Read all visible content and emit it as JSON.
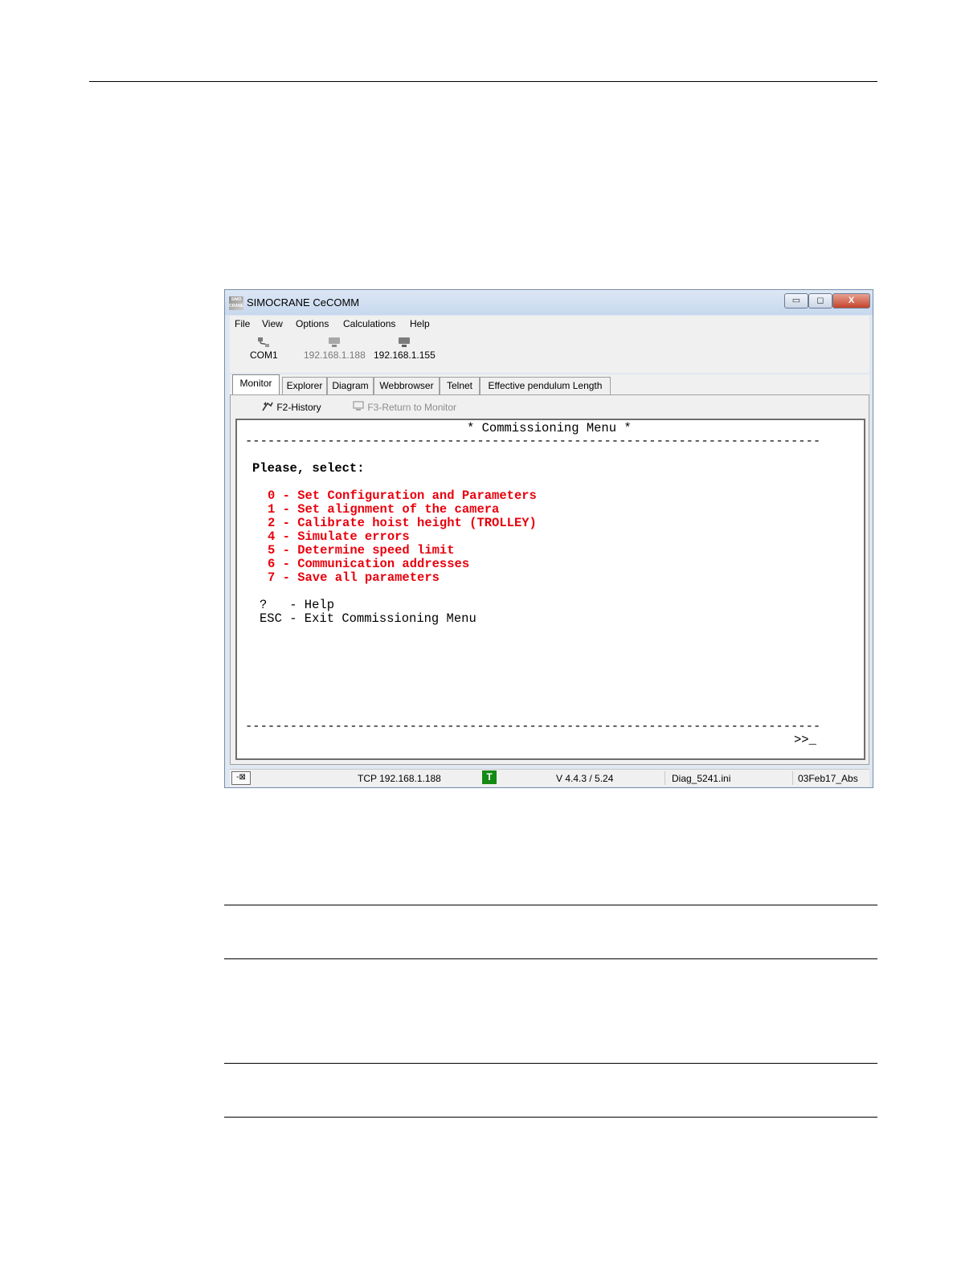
{
  "window": {
    "title": "SIMOCRANE CeCOMM",
    "icon_label": "SIMO CRANE"
  },
  "window_controls": {
    "minimize": "▭",
    "maximize": "◻",
    "close": "X"
  },
  "menu": [
    "File",
    "View",
    "Options",
    "Calculations",
    "Help"
  ],
  "toolbar": [
    {
      "label": "COM1",
      "icon": "serial-port-icon"
    },
    {
      "label": "192.168.1.188",
      "icon": "network-icon"
    },
    {
      "label": "192.168.1.155",
      "icon": "network-icon"
    }
  ],
  "tabs": [
    "Monitor",
    "Explorer",
    "Diagram",
    "Webbrowser",
    "Telnet",
    "Effective pendulum Length"
  ],
  "active_tab": "Monitor",
  "subtoolbar": {
    "history": "F2-History",
    "return": "F3-Return to Monitor"
  },
  "terminal": {
    "header": "* Commissioning Menu *",
    "separator": "-----------------------------------------------------------------------------",
    "prompt_heading": "Please, select:",
    "options": [
      "0 - Set Configuration and Parameters",
      "1 - Set alignment of the camera",
      "2 - Calibrate hoist height (TROLLEY)",
      "4 - Simulate errors",
      "5 - Determine speed limit",
      "6 - Communication addresses",
      "7 - Save all parameters"
    ],
    "help_line": "?   - Help",
    "exit_line": "ESC - Exit Commissioning Menu",
    "cursor": ">>_"
  },
  "status": {
    "pin": "-⊠",
    "connection": "TCP 192.168.1.188",
    "mode_badge": "T",
    "version": "V 4.4.3 / 5.24",
    "ini_file": "Diag_5241.ini",
    "build": "03Feb17_Abs"
  }
}
